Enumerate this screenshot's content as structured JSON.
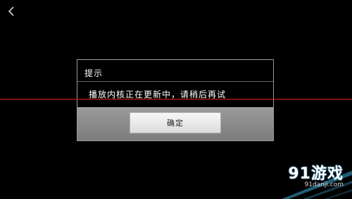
{
  "dialog": {
    "title": "提示",
    "message": "播放内核正在更新中，请稍后再试",
    "ok_label": "确定"
  },
  "nav": {
    "back_icon": "chevron-left-icon"
  },
  "watermark": {
    "logo": "91游戏",
    "url": "91danji.com"
  },
  "colors": {
    "background": "#000000",
    "dialog_border": "#9a9a9a",
    "footer": "#8a8a8a",
    "red_line": "#e02020",
    "watermark_accent": "#3fa9d9"
  }
}
